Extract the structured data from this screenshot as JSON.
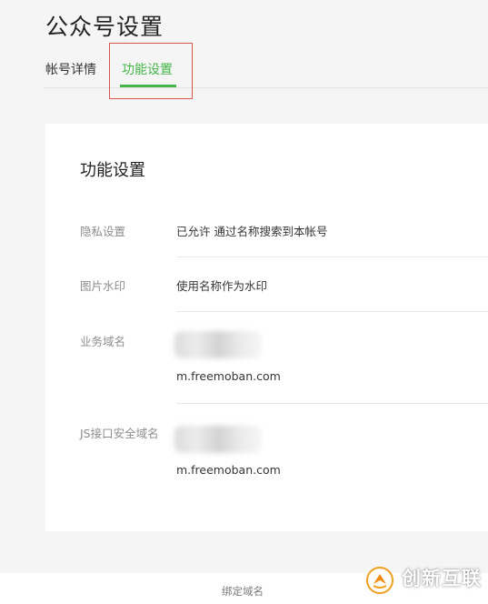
{
  "page": {
    "title": "公众号设置"
  },
  "tabs": [
    {
      "label": "帐号详情",
      "active": false
    },
    {
      "label": "功能设置",
      "active": true
    }
  ],
  "colors": {
    "accent": "#44b549",
    "highlight": "#d9534f"
  },
  "card": {
    "title": "功能设置",
    "rows": [
      {
        "label": "隐私设置",
        "value": "已允许 通过名称搜索到本帐号"
      },
      {
        "label": "图片水印",
        "value": "使用名称作为水印"
      },
      {
        "label": "业务域名",
        "value": "m.freemoban.com"
      },
      {
        "label": "JS接口安全域名",
        "value": "m.freemoban.com"
      }
    ]
  },
  "footer": {
    "link": "绑定域名"
  },
  "watermark": {
    "text": "创新互联",
    "icon": "brand-logo-icon"
  }
}
